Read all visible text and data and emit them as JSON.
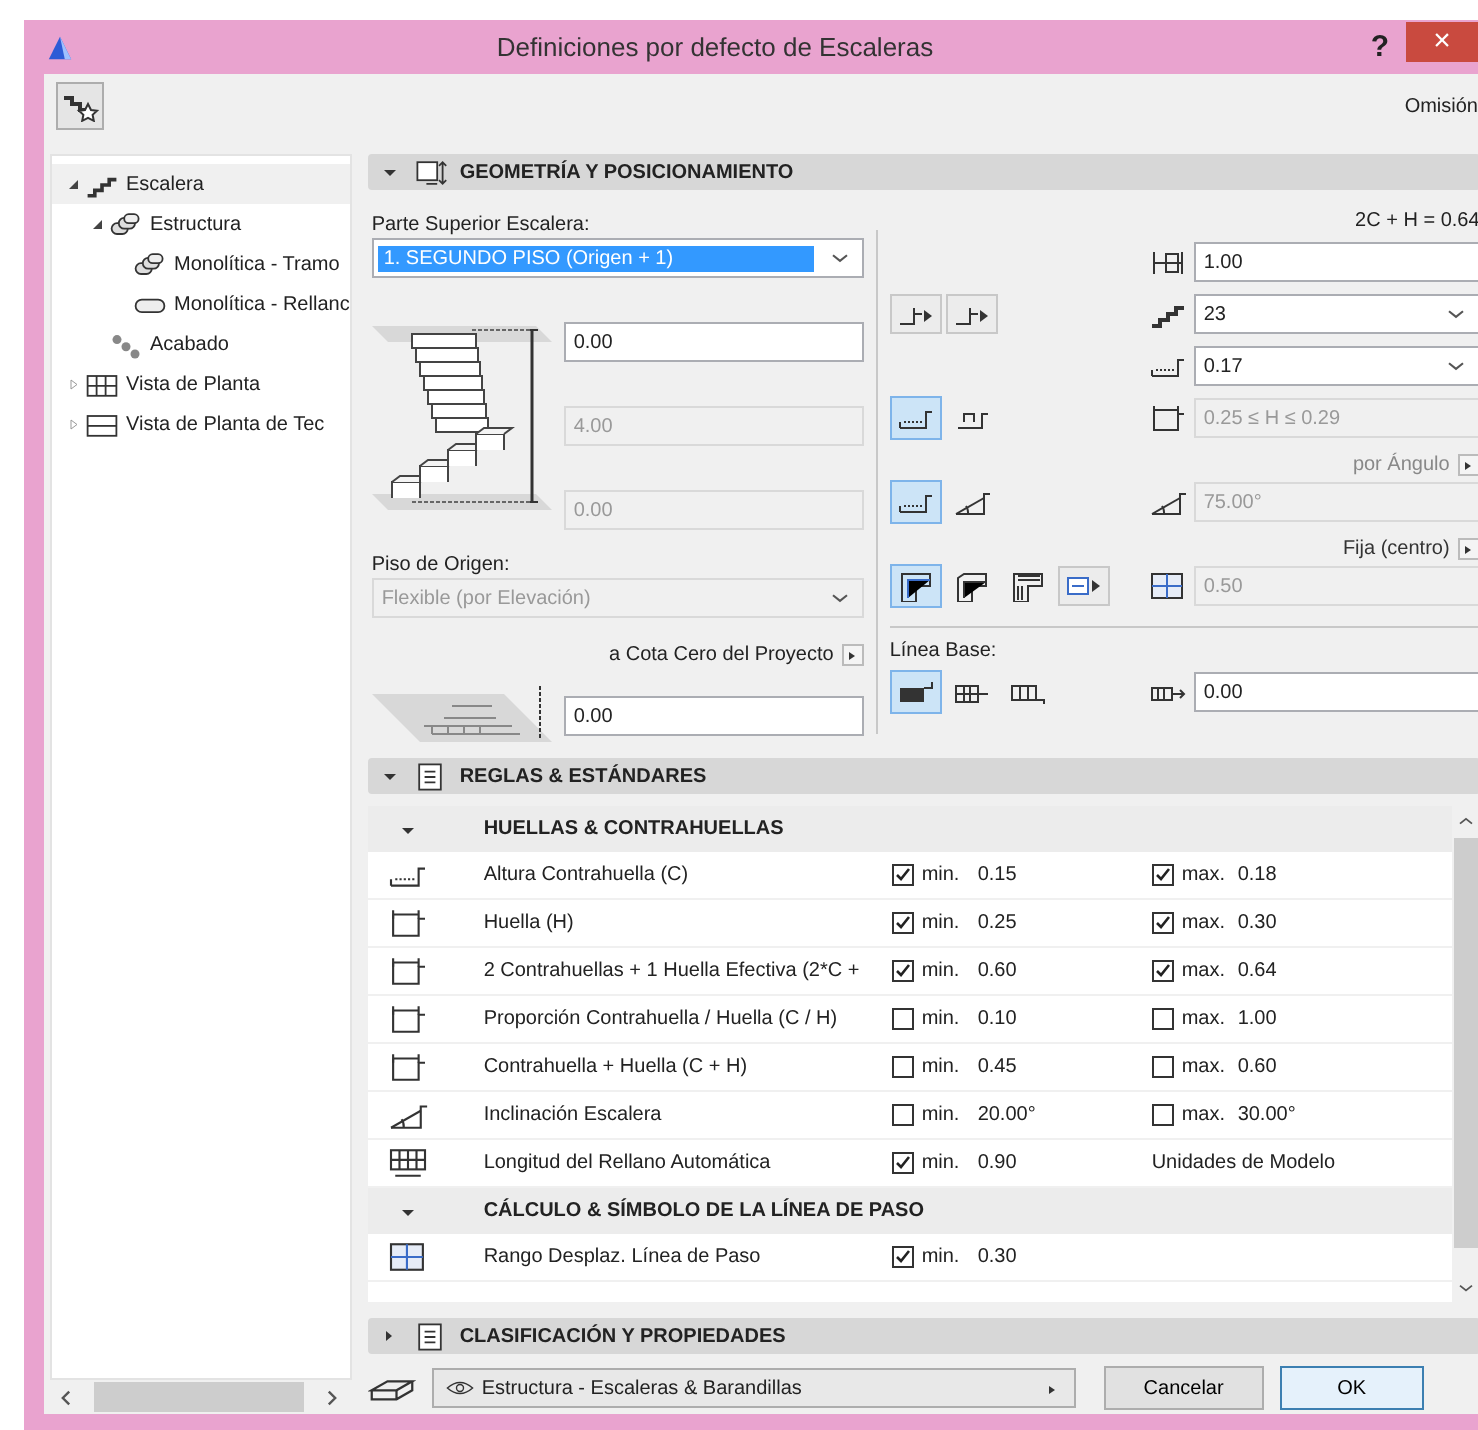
{
  "window": {
    "title": "Definiciones por defecto de Escaleras",
    "help": "?",
    "close": "×"
  },
  "toolbar": {
    "label": "Omisión"
  },
  "tree": [
    {
      "label": "Escalera",
      "kind": "stair",
      "expandable": true,
      "expanded": true,
      "selected": true,
      "children": [
        {
          "label": "Estructura",
          "kind": "structure",
          "expandable": true,
          "expanded": true,
          "selected": false,
          "children": [
            {
              "label": "Monolítica - Tramo",
              "kind": "flight",
              "expandable": false,
              "selected": false
            },
            {
              "label": "Monolítica - Rellanc",
              "kind": "landing",
              "expandable": false,
              "selected": false
            }
          ]
        },
        {
          "label": "Acabado",
          "kind": "finish",
          "expandable": false,
          "selected": false
        }
      ]
    },
    {
      "label": "Vista de Planta",
      "kind": "plan",
      "expandable": true,
      "expanded": false,
      "selected": false
    },
    {
      "label": "Vista de Planta de Tec",
      "kind": "ceiling",
      "expandable": true,
      "expanded": false,
      "selected": false
    }
  ],
  "geometry": {
    "title": "GEOMETRÍA Y POSICIONAMIENTO",
    "expanded": true,
    "top_label": "Parte Superior Escalera:",
    "top_story": {
      "value": "1. SEGUNDO PISO (Origen + 1)",
      "highlighted": true,
      "disabled": false
    },
    "top_offset": {
      "value": "0.00",
      "disabled": false
    },
    "height": {
      "value": "4.00",
      "disabled": true
    },
    "bottom_offset": {
      "value": "0.00",
      "disabled": true
    },
    "origin_label": "Piso de Origen:",
    "origin_story": {
      "value": "Flexible (por Elevación)",
      "highlighted": false,
      "disabled": true
    },
    "reference_label": "a Cota Cero del Proyecto",
    "reference_offset": {
      "value": "0.00",
      "disabled": false
    },
    "formula": "2C + H = 0.64",
    "width": {
      "value": "1.00",
      "disabled": false
    },
    "risers": {
      "value": "23",
      "disabled": false
    },
    "riser_height": {
      "value": "0.17",
      "disabled": false
    },
    "tread_range": {
      "value": "0.25 ≤ H ≤ 0.29",
      "disabled": true
    },
    "tread_modes": [
      {
        "selected": true
      },
      {
        "selected": false
      }
    ],
    "angle_mode": "por Ángulo",
    "slope_modes": [
      {
        "selected": true
      },
      {
        "selected": false
      }
    ],
    "angle": {
      "value": "75.00°",
      "disabled": true
    },
    "walkline_mode": "Fija (centro)",
    "walkline_modes": [
      {
        "selected": true
      },
      {
        "selected": false
      },
      {
        "selected": false
      }
    ],
    "walkline_offset": {
      "value": "0.50",
      "disabled": true
    },
    "baseline_label": "Línea Base:",
    "baseline_modes": [
      {
        "selected": true
      },
      {
        "selected": false
      },
      {
        "selected": false
      }
    ],
    "baseline_offset": {
      "value": "0.00",
      "disabled": false
    }
  },
  "rules": {
    "title": "REGLAS & ESTÁNDARES",
    "expanded": true,
    "groups": [
      {
        "title": "HUELLAS & CONTRAHUELLAS",
        "expanded": true,
        "rows": [
          {
            "kind": "riser",
            "label": "Altura Contrahuella (C)",
            "min": {
              "checked": true,
              "label": "min.",
              "value": "0.15"
            },
            "max": {
              "checked": true,
              "label": "max.",
              "value": "0.18"
            }
          },
          {
            "kind": "tread",
            "label": "Huella (H)",
            "min": {
              "checked": true,
              "label": "min.",
              "value": "0.25"
            },
            "max": {
              "checked": true,
              "label": "max.",
              "value": "0.30"
            }
          },
          {
            "kind": "combo",
            "label": "2 Contrahuellas + 1 Huella Efectiva (2*C +",
            "min": {
              "checked": true,
              "label": "min.",
              "value": "0.60"
            },
            "max": {
              "checked": true,
              "label": "max.",
              "value": "0.64"
            }
          },
          {
            "kind": "ratio",
            "label": "Proporción Contrahuella / Huella (C / H)",
            "min": {
              "checked": false,
              "label": "min.",
              "value": "0.10"
            },
            "max": {
              "checked": false,
              "label": "max.",
              "value": "1.00"
            }
          },
          {
            "kind": "sum",
            "label": "Contrahuella + Huella (C + H)",
            "min": {
              "checked": false,
              "label": "min.",
              "value": "0.45"
            },
            "max": {
              "checked": false,
              "label": "max.",
              "value": "0.60"
            }
          },
          {
            "kind": "slope",
            "label": "Inclinación Escalera",
            "min": {
              "checked": false,
              "label": "min.",
              "value": "20.00°"
            },
            "max": {
              "checked": false,
              "label": "max.",
              "value": "30.00°"
            }
          },
          {
            "kind": "landing",
            "label": "Longitud del Rellano Automática",
            "min": {
              "checked": true,
              "label": "min.",
              "value": "0.90"
            },
            "note": "Unidades de Modelo"
          }
        ]
      },
      {
        "title": "CÁLCULO & SÍMBOLO DE LA LÍNEA DE PASO",
        "expanded": true,
        "rows": [
          {
            "kind": "walkline",
            "label": "Rango Desplaz. Línea de Paso",
            "min": {
              "checked": true,
              "label": "min.",
              "value": "0.30"
            }
          }
        ]
      }
    ]
  },
  "classification": {
    "title": "CLASIFICACIÓN Y PROPIEDADES",
    "expanded": false
  },
  "footer": {
    "layer": "Estructura - Escaleras & Barandillas",
    "buttons": [
      {
        "label": "Cancelar",
        "default": false
      },
      {
        "label": "OK",
        "default": true
      }
    ]
  }
}
